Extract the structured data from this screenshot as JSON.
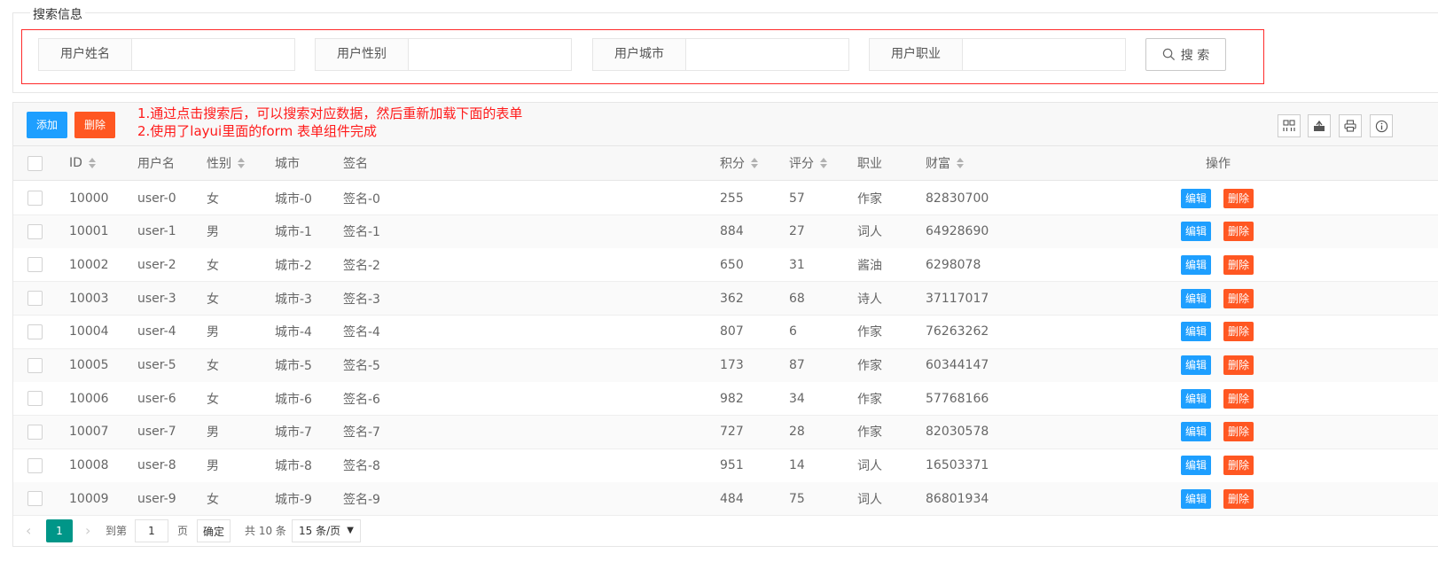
{
  "search": {
    "legend": "搜索信息",
    "fields": [
      {
        "label": "用户姓名",
        "value": ""
      },
      {
        "label": "用户性别",
        "value": ""
      },
      {
        "label": "用户城市",
        "value": ""
      },
      {
        "label": "用户职业",
        "value": ""
      }
    ],
    "button_label": "搜 索"
  },
  "toolbar": {
    "add_label": "添加",
    "delete_label": "删除",
    "note_line1": "1.通过点击搜索后，可以搜索对应数据，然后重新加载下面的表单",
    "note_line2": "2.使用了layui里面的form 表单组件完成",
    "tools": [
      "columns-icon",
      "export-icon",
      "print-icon",
      "info-icon"
    ]
  },
  "table": {
    "columns": [
      "ID",
      "用户名",
      "性别",
      "城市",
      "签名",
      "积分",
      "评分",
      "职业",
      "财富",
      "操作"
    ],
    "sortable": [
      "ID",
      "性别",
      "积分",
      "评分",
      "财富"
    ],
    "edit_label": "编辑",
    "delete_label": "删除",
    "rows": [
      {
        "id": "10000",
        "username": "user-0",
        "sex": "女",
        "city": "城市-0",
        "sign": "签名-0",
        "score": "255",
        "rating": "57",
        "job": "作家",
        "wealth": "82830700"
      },
      {
        "id": "10001",
        "username": "user-1",
        "sex": "男",
        "city": "城市-1",
        "sign": "签名-1",
        "score": "884",
        "rating": "27",
        "job": "词人",
        "wealth": "64928690"
      },
      {
        "id": "10002",
        "username": "user-2",
        "sex": "女",
        "city": "城市-2",
        "sign": "签名-2",
        "score": "650",
        "rating": "31",
        "job": "酱油",
        "wealth": "6298078"
      },
      {
        "id": "10003",
        "username": "user-3",
        "sex": "女",
        "city": "城市-3",
        "sign": "签名-3",
        "score": "362",
        "rating": "68",
        "job": "诗人",
        "wealth": "37117017"
      },
      {
        "id": "10004",
        "username": "user-4",
        "sex": "男",
        "city": "城市-4",
        "sign": "签名-4",
        "score": "807",
        "rating": "6",
        "job": "作家",
        "wealth": "76263262"
      },
      {
        "id": "10005",
        "username": "user-5",
        "sex": "女",
        "city": "城市-5",
        "sign": "签名-5",
        "score": "173",
        "rating": "87",
        "job": "作家",
        "wealth": "60344147"
      },
      {
        "id": "10006",
        "username": "user-6",
        "sex": "女",
        "city": "城市-6",
        "sign": "签名-6",
        "score": "982",
        "rating": "34",
        "job": "作家",
        "wealth": "57768166"
      },
      {
        "id": "10007",
        "username": "user-7",
        "sex": "男",
        "city": "城市-7",
        "sign": "签名-7",
        "score": "727",
        "rating": "28",
        "job": "作家",
        "wealth": "82030578"
      },
      {
        "id": "10008",
        "username": "user-8",
        "sex": "男",
        "city": "城市-8",
        "sign": "签名-8",
        "score": "951",
        "rating": "14",
        "job": "词人",
        "wealth": "16503371"
      },
      {
        "id": "10009",
        "username": "user-9",
        "sex": "女",
        "city": "城市-9",
        "sign": "签名-9",
        "score": "484",
        "rating": "75",
        "job": "词人",
        "wealth": "86801934"
      }
    ]
  },
  "pager": {
    "current_page": "1",
    "goto_label": "到第",
    "goto_value": "1",
    "page_unit": "页",
    "confirm_label": "确定",
    "total_label": "共 10 条",
    "page_size_label": "15 条/页"
  }
}
